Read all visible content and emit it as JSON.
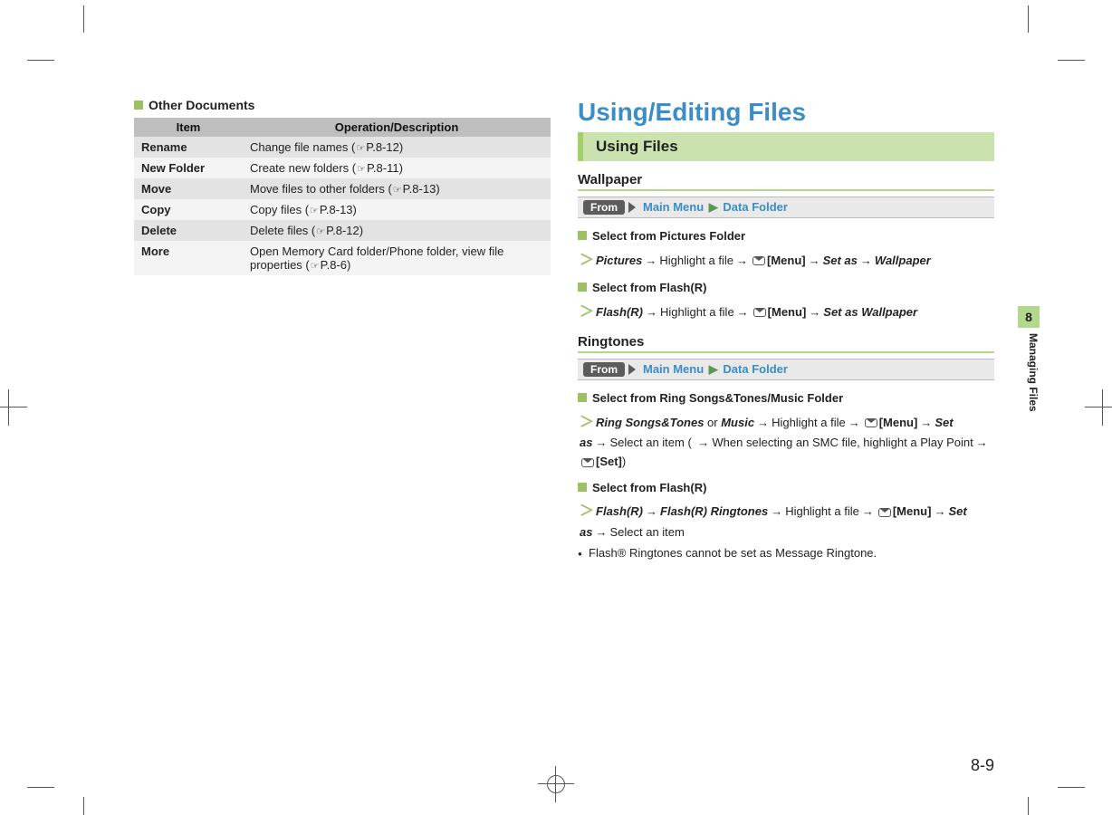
{
  "left": {
    "title": "Other Documents",
    "headers": [
      "Item",
      "Operation/Description"
    ],
    "rows": [
      {
        "item": "Rename",
        "desc_pre": "Change file names (",
        "ref": "P.8-12",
        "desc_post": ")"
      },
      {
        "item": "New Folder",
        "desc_pre": "Create new folders (",
        "ref": "P.8-11",
        "desc_post": ")"
      },
      {
        "item": "Move",
        "desc_pre": "Move files to other folders (",
        "ref": "P.8-13",
        "desc_post": ")"
      },
      {
        "item": "Copy",
        "desc_pre": "Copy files (",
        "ref": "P.8-13",
        "desc_post": ")"
      },
      {
        "item": "Delete",
        "desc_pre": "Delete files (",
        "ref": "P.8-12",
        "desc_post": ")"
      },
      {
        "item": "More",
        "desc_pre": "Open Memory Card folder/Phone folder, view file properties (",
        "ref": "P.8-6",
        "desc_post": ")"
      }
    ]
  },
  "right": {
    "title": "Using/Editing Files",
    "subband": "Using Files",
    "sec1": {
      "head": "Wallpaper",
      "from_label": "From",
      "from_path1": "Main Menu",
      "from_path2": "Data Folder",
      "b1_title": "Select from Pictures Folder",
      "b1_s_pictures": "Pictures",
      "b1_s_hl": "Highlight a file",
      "b1_s_menu": "[Menu]",
      "b1_s_setas": "Set as",
      "b1_s_wall": "Wallpaper",
      "b2_title": "Select from Flash(R)",
      "b2_s_flash": "Flash(R)",
      "b2_s_hl": "Highlight a file",
      "b2_s_menu": "[Menu]",
      "b2_s_setwall": "Set as Wallpaper"
    },
    "sec2": {
      "head": "Ringtones",
      "from_label": "From",
      "from_path1": "Main Menu",
      "from_path2": "Data Folder",
      "b1_title": "Select from Ring Songs&Tones/Music Folder",
      "b1_s_rst": "Ring Songs&Tones",
      "b1_s_or": " or ",
      "b1_s_music": "Music",
      "b1_s_hl": "Highlight a file",
      "b1_s_menu": "[Menu]",
      "b1_s_setas": "Set as",
      "b1_s_sel": "Select an item ( ",
      "b1_s_smc": "When selecting an SMC file, highlight a Play Point",
      "b1_s_set": "[Set]",
      "b1_s_close": ")",
      "b2_title": "Select from Flash(R)",
      "b2_s_flash": "Flash(R)",
      "b2_s_fr": "Flash(R) Ringtones",
      "b2_s_hl": "Highlight a file",
      "b2_s_menu": "[Menu]",
      "b2_s_setas": "Set as",
      "b2_s_sel": "Select an item",
      "note_pre": "Flash® Ringtones cannot be set as ",
      "note_b": "Message Ringtone",
      "note_post": "."
    }
  },
  "sidetab": {
    "num": "8",
    "text": "Managing Files"
  },
  "pagenum": "8-9"
}
